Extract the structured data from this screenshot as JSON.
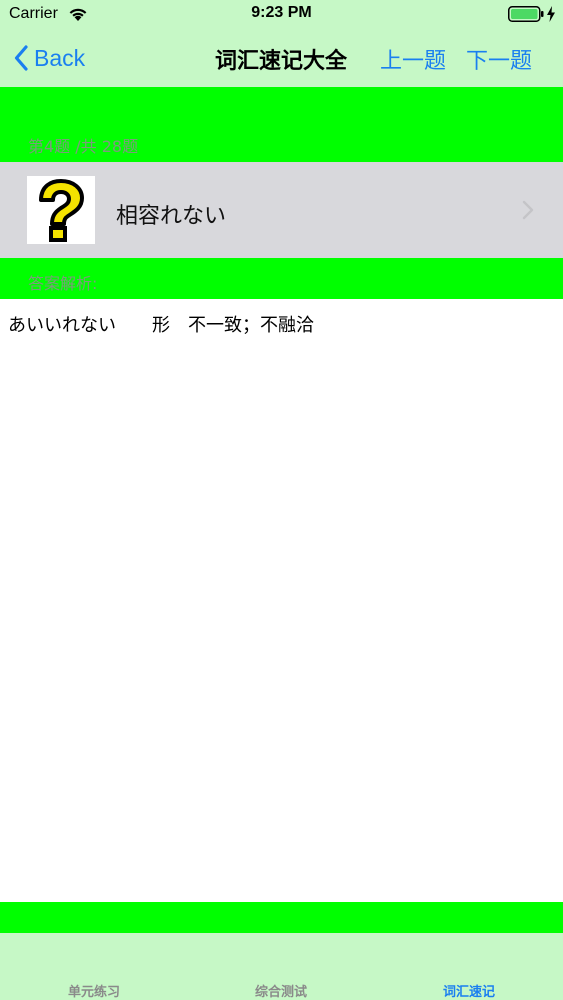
{
  "status_bar": {
    "carrier": "Carrier",
    "time": "9:23 PM"
  },
  "nav": {
    "back_label": "Back",
    "title": "词汇速记大全",
    "prev_label": "上一题",
    "next_label": "下一题"
  },
  "question": {
    "counter": "第4题 /共 28题",
    "icon": "question-mark-icon",
    "word": "相容れない"
  },
  "analysis": {
    "label": "答案解析:",
    "text": "あいいれない　　形　不一致；不融洽"
  },
  "tabs": [
    {
      "label": "单元练习",
      "active": false
    },
    {
      "label": "综合测试",
      "active": false
    },
    {
      "label": "词汇速记",
      "active": true
    }
  ],
  "colors": {
    "accent": "#1a7ff0",
    "band_green": "#00ff00",
    "bar_green": "#c6f8c6"
  }
}
